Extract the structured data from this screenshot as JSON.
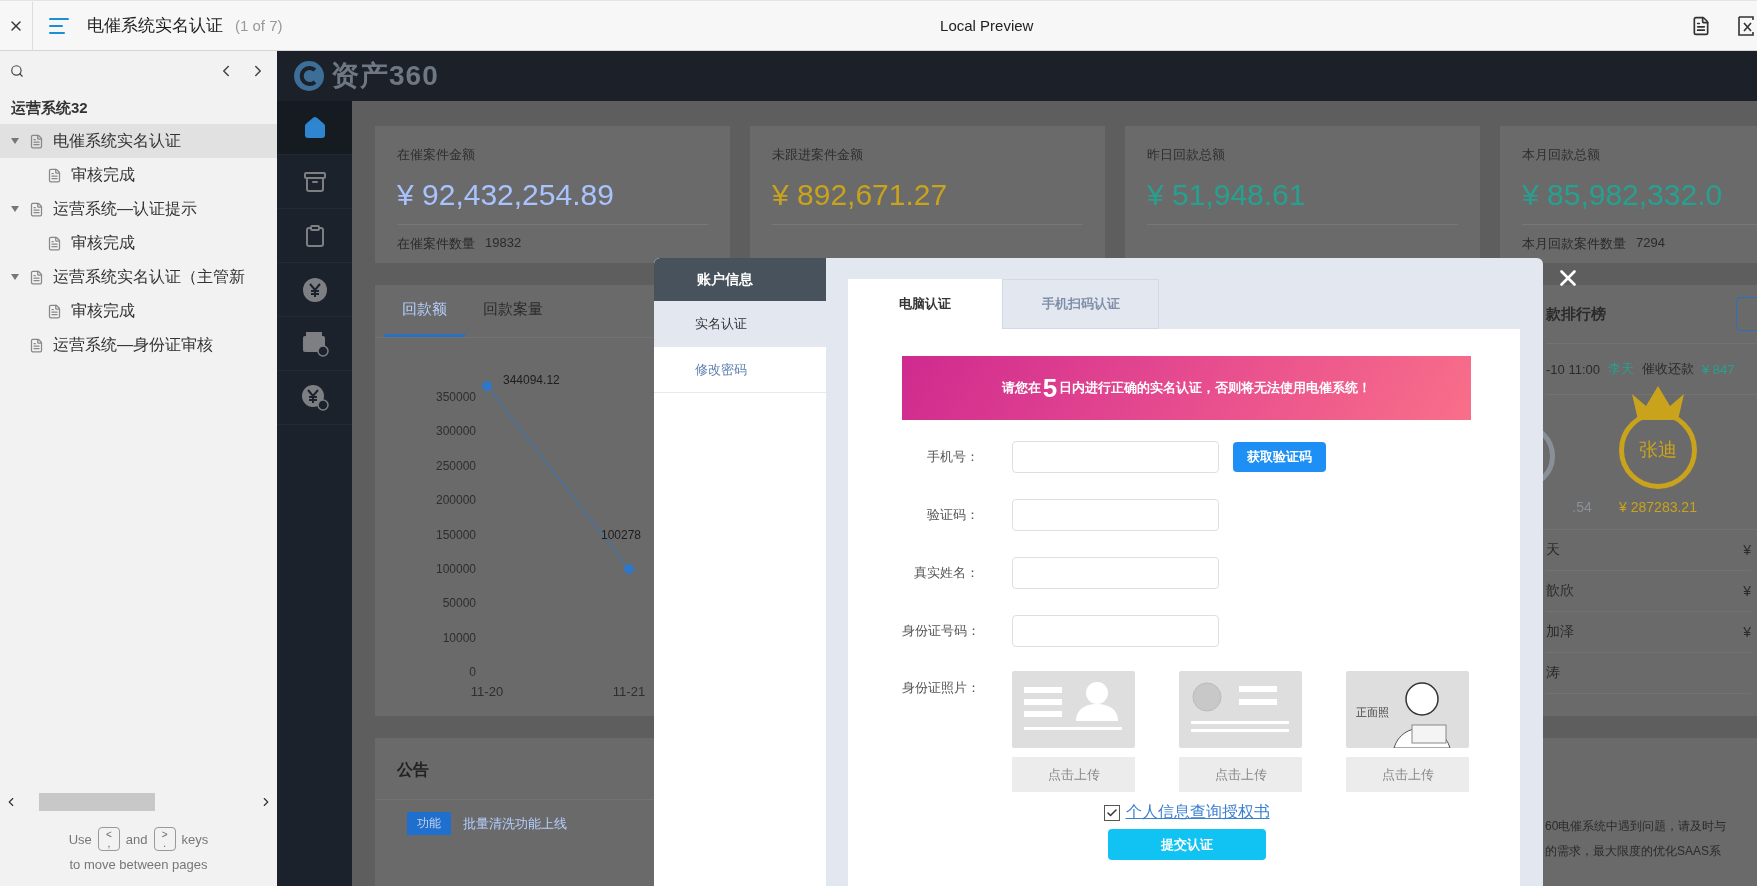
{
  "viewer": {
    "title": "电催系统实名认证",
    "page_count": "(1 of 7)",
    "center_title": "Local Preview"
  },
  "outline": {
    "heading": "运营系统32",
    "items": [
      {
        "label": "电催系统实名认证",
        "selected": true,
        "expanded": true,
        "children": [
          {
            "label": "审核完成",
            "selected": false
          }
        ]
      },
      {
        "label": "运营系统—认证提示",
        "selected": false,
        "expanded": true,
        "children": [
          {
            "label": "审核完成",
            "selected": false
          }
        ]
      },
      {
        "label": "运营系统实名认证（主管新",
        "selected": false,
        "expanded": true,
        "children": [
          {
            "label": "审核完成",
            "selected": false
          }
        ]
      },
      {
        "label": "运营系统—身份证审核",
        "selected": false
      }
    ]
  },
  "key_hint": {
    "before": "Use",
    "prev_key": {
      "top": "<",
      "bottom": ","
    },
    "middle": "and",
    "next_key": {
      "top": ">",
      "bottom": "."
    },
    "after": "keys",
    "line2": "to move between pages"
  },
  "app": {
    "logo": "资产360",
    "nav": [
      {
        "kind": "home",
        "selected": true
      },
      {
        "kind": "box",
        "selected": false
      },
      {
        "kind": "clipboard",
        "selected": false
      },
      {
        "kind": "yen",
        "selected": false
      },
      {
        "kind": "box_badge",
        "selected": false
      },
      {
        "kind": "yen_badge",
        "selected": false
      }
    ],
    "stats": [
      {
        "title": "在催案件金额",
        "value": "¥ 92,432,254.89",
        "color": "#a9c3ff",
        "footer": "在催案件数量",
        "count": "19832"
      },
      {
        "title": "未跟进案件金额",
        "value": "¥ 892,671.27",
        "color": "#c9a31b"
      },
      {
        "title": "昨日回款总额",
        "value": "¥ 51,948.61",
        "color": "#27a090"
      },
      {
        "title": "本月回款总额",
        "value": "¥ 85,982,332.0",
        "color": "#27a090",
        "footer": "本月回款案件数量",
        "count": "7294"
      }
    ],
    "chart_tabs": [
      {
        "label": "回款额",
        "selected": true
      },
      {
        "label": "回款案量",
        "selected": false
      }
    ],
    "chart": {
      "y_labels": [
        "350000",
        "300000",
        "250000",
        "200000",
        "150000",
        "100000",
        "50000",
        "10000",
        "0"
      ],
      "x_labels": [
        "11-20",
        "11-21"
      ],
      "point_labels": [
        "344094.12",
        "100278"
      ]
    },
    "ranking": {
      "title": "款排行榜",
      "record": {
        "time": "-10 11:00",
        "name": "李天",
        "action": "催收还款",
        "amount": "¥ 847"
      },
      "podium": [
        {
          "kind": "silver",
          "amount": ".54"
        },
        {
          "kind": "gold",
          "name": "张迪",
          "amount": "¥ 287283.21"
        }
      ],
      "rows": [
        {
          "name": "天",
          "amount": "¥"
        },
        {
          "name": "歆欣",
          "amount": "¥"
        },
        {
          "name": "加泽",
          "amount": "¥"
        },
        {
          "name": "涛"
        }
      ]
    },
    "announcements": {
      "title": "公告",
      "items": [
        {
          "tag": "功能",
          "color": "#1f6fcf",
          "text": "批量清洗功能上线"
        }
      ]
    },
    "notice": [
      "60电催系统中遇到问题，请及时与",
      "的需求，最大限度的优化SAAS系"
    ]
  },
  "modal": {
    "sidebar": {
      "title": "账户信息",
      "items": [
        {
          "label": "实名认证",
          "selected": true
        },
        {
          "label": "修改密码",
          "selected": false
        }
      ]
    },
    "tabs": [
      {
        "label": "电脑认证",
        "selected": true
      },
      {
        "label": "手机扫码认证",
        "selected": false
      }
    ],
    "banner": {
      "before": "请您在",
      "highlight": "5",
      "after": "日内进行正确的实名认证，否则将无法使用电催系统！"
    },
    "fields": [
      {
        "label": "手机号：",
        "action": "获取验证码"
      },
      {
        "label": "验证码："
      },
      {
        "label": "真实姓名："
      },
      {
        "label": "身份证号码："
      }
    ],
    "photos": {
      "label": "身份证照片：",
      "items": [
        {
          "kind": "id_front",
          "button": "点击上传"
        },
        {
          "kind": "id_back",
          "button": "点击上传"
        },
        {
          "kind": "portrait",
          "caption": "正面照",
          "button": "点击上传"
        }
      ]
    },
    "consent": {
      "checked": true,
      "link": "个人信息查询授权书"
    },
    "submit": "提交认证"
  }
}
